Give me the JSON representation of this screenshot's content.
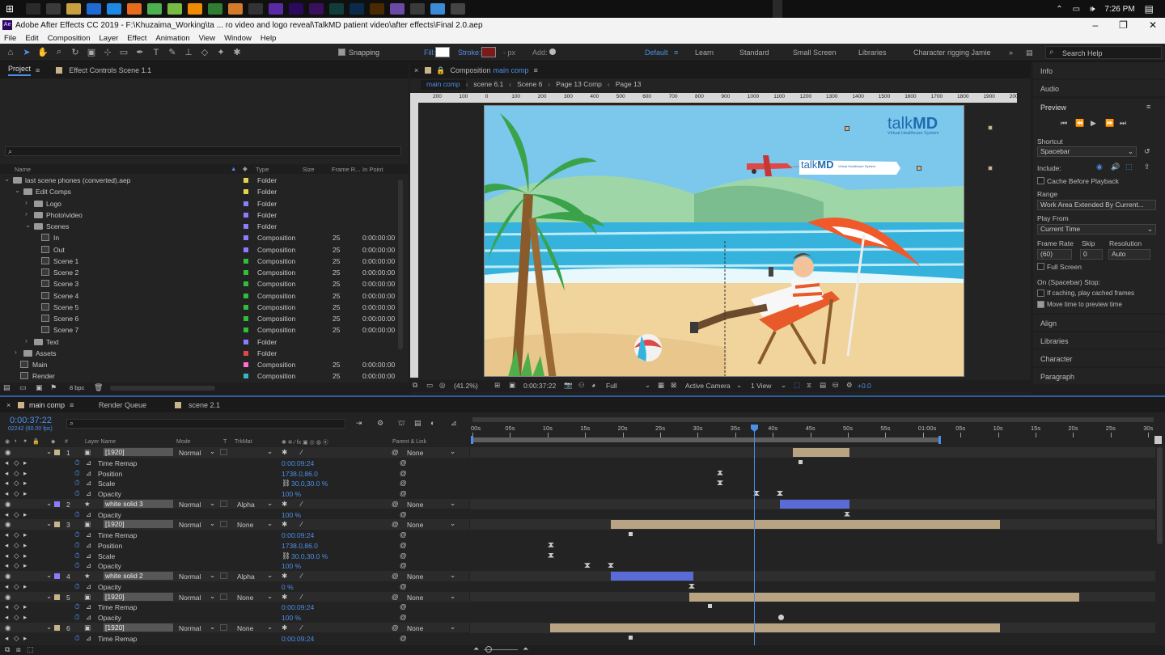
{
  "taskbar": {
    "time": "7:26 PM",
    "icons": [
      "windows-icon",
      "task-view-icon",
      "file-explorer-icon",
      "folder-icon",
      "outlook-icon",
      "skype-icon",
      "firefox-icon",
      "chrome-icon",
      "app-icon",
      "vlc-icon",
      "camtasia-icon",
      "blender-icon",
      "obs-icon",
      "character-animator-icon",
      "after-effects-icon",
      "premiere-icon",
      "audition-icon",
      "photoshop-icon",
      "illustrator-icon",
      "pen-icon",
      "drop-icon",
      "globe-icon",
      "photos-icon"
    ]
  },
  "window": {
    "title": "Adobe After Effects CC 2019 - F:\\Khuzaima_Working\\ta ... ro video and logo reveal\\TalkMD patient video\\after effects\\Final 2.0.aep",
    "app_badge": "Ae"
  },
  "menu": [
    "File",
    "Edit",
    "Composition",
    "Layer",
    "Effect",
    "Animation",
    "View",
    "Window",
    "Help"
  ],
  "toolbar": {
    "snapping": "Snapping",
    "fill": "Fill:",
    "stroke": "Stroke:",
    "px": "- px",
    "add": "Add:",
    "workspaces": [
      "Default",
      "Learn",
      "Standard",
      "Small Screen",
      "Libraries",
      "Character rigging Jamie"
    ],
    "search": "Search Help"
  },
  "project": {
    "tab": "Project",
    "effect_tab": "Effect Controls Scene 1.1",
    "columns": [
      "Name",
      "Type",
      "Size",
      "Frame R...",
      "In Point"
    ],
    "bpc": "8 bpc",
    "items": [
      {
        "indent": 0,
        "name": "last scene phones (converted).aep",
        "type": "Folder",
        "color": "#e7d34a",
        "kind": "folder",
        "arrow": "v"
      },
      {
        "indent": 1,
        "name": "Edit Comps",
        "type": "Folder",
        "color": "#e7d34a",
        "kind": "folder",
        "arrow": "v"
      },
      {
        "indent": 2,
        "name": "Logo",
        "type": "Folder",
        "color": "#8a7dff",
        "kind": "folder",
        "arrow": ">"
      },
      {
        "indent": 2,
        "name": "Photo\\video",
        "type": "Folder",
        "color": "#8a7dff",
        "kind": "folder",
        "arrow": ">"
      },
      {
        "indent": 2,
        "name": "Scenes",
        "type": "Folder",
        "color": "#8a7dff",
        "kind": "folder",
        "arrow": "v"
      },
      {
        "indent": 3,
        "name": "In",
        "type": "Composition",
        "color": "#8a7dff",
        "kind": "comp",
        "fr": "25",
        "inp": "0:00:00:00"
      },
      {
        "indent": 3,
        "name": "Out",
        "type": "Composition",
        "color": "#8a7dff",
        "kind": "comp",
        "fr": "25",
        "inp": "0:00:00:00"
      },
      {
        "indent": 3,
        "name": "Scene 1",
        "type": "Composition",
        "color": "#2fbf3a",
        "kind": "comp",
        "fr": "25",
        "inp": "0:00:00:00"
      },
      {
        "indent": 3,
        "name": "Scene 2",
        "type": "Composition",
        "color": "#2fbf3a",
        "kind": "comp",
        "fr": "25",
        "inp": "0:00:00:00"
      },
      {
        "indent": 3,
        "name": "Scene 3",
        "type": "Composition",
        "color": "#2fbf3a",
        "kind": "comp",
        "fr": "25",
        "inp": "0:00:00:00"
      },
      {
        "indent": 3,
        "name": "Scene 4",
        "type": "Composition",
        "color": "#2fbf3a",
        "kind": "comp",
        "fr": "25",
        "inp": "0:00:00:00"
      },
      {
        "indent": 3,
        "name": "Scene 5",
        "type": "Composition",
        "color": "#2fbf3a",
        "kind": "comp",
        "fr": "25",
        "inp": "0:00:00:00"
      },
      {
        "indent": 3,
        "name": "Scene 6",
        "type": "Composition",
        "color": "#2fbf3a",
        "kind": "comp",
        "fr": "25",
        "inp": "0:00:00:00"
      },
      {
        "indent": 3,
        "name": "Scene 7",
        "type": "Composition",
        "color": "#2fbf3a",
        "kind": "comp",
        "fr": "25",
        "inp": "0:00:00:00"
      },
      {
        "indent": 2,
        "name": "Text",
        "type": "Folder",
        "color": "#8a7dff",
        "kind": "folder",
        "arrow": ">"
      },
      {
        "indent": 1,
        "name": "Assets",
        "type": "Folder",
        "color": "#e04848",
        "kind": "folder",
        "arrow": ">"
      },
      {
        "indent": 1,
        "name": "Main",
        "type": "Composition",
        "color": "#ff6fd0",
        "kind": "comp",
        "fr": "25",
        "inp": "0:00:00:00"
      },
      {
        "indent": 1,
        "name": "Render",
        "type": "Composition",
        "color": "#3ab5c7",
        "kind": "comp",
        "fr": "25",
        "inp": "0:00:00:00"
      }
    ]
  },
  "composition": {
    "title": "Composition",
    "name": "main comp",
    "crumbs": [
      "main comp",
      "scene 6.1",
      "Scene 6",
      "Page 13 Comp",
      "Page 13"
    ],
    "ruler": [
      "200",
      "100",
      "0",
      "100",
      "200",
      "300",
      "400",
      "500",
      "600",
      "700",
      "800",
      "900",
      "1000",
      "1100",
      "1200",
      "1300",
      "1400",
      "1500",
      "1600",
      "1700",
      "1800",
      "1900",
      "2000"
    ],
    "zoom": "(41.2%)",
    "timecode": "0:00:37:22",
    "resolution": "Full",
    "camera": "Active Camera",
    "views": "1 View",
    "exposure": "+0.0",
    "logo_talk": "talk",
    "logo_md": "MD",
    "logo_tagline": "Virtual Healthcare System",
    "banner_tagline": "Virtual Healthcare System",
    "colors": {
      "sky": "#7cc8ec",
      "sea": "#35b3dd",
      "sand": "#f1d49c",
      "logo_blue": "#1f6bb0"
    }
  },
  "right": {
    "info": "Info",
    "audio": "Audio",
    "preview": "Preview",
    "shortcut_label": "Shortcut",
    "shortcut": "Spacebar",
    "include": "Include:",
    "cache": "Cache Before Playback",
    "range_label": "Range",
    "range": "Work Area Extended By Current...",
    "playfrom_label": "Play From",
    "playfrom": "Current Time",
    "fr_label": "Frame Rate",
    "skip_label": "Skip",
    "res_label": "Resolution",
    "fr": "(60)",
    "skip": "0",
    "res": "Auto",
    "fullscreen": "Full Screen",
    "stop": "On (Spacebar) Stop:",
    "ifcaching": "If caching, play cached frames",
    "movetime": "Move time to preview time",
    "align": "Align",
    "libraries": "Libraries",
    "character": "Character",
    "paragraph": "Paragraph"
  },
  "timeline": {
    "tabs": [
      "main comp",
      "Render Queue",
      "scene 2.1"
    ],
    "time": "0:00:37:22",
    "frames": "02242 (60.00 fps)",
    "cols": {
      "num": "#",
      "layer": "Layer Name",
      "mode": "Mode",
      "t": "T",
      "trkmat": "TrkMat",
      "parent": "Parent & Link"
    },
    "ruler": [
      "00s",
      "05s",
      "10s",
      "15s",
      "20s",
      "25s",
      "30s",
      "35s",
      "40s",
      "45s",
      "50s",
      "55s",
      "01:00s",
      "05s",
      "10s",
      "15s",
      "20s",
      "25s",
      "30s"
    ],
    "rows": [
      {
        "kind": "layer",
        "num": "1",
        "name": "[1920]",
        "color": "#c9b48a",
        "mode": "Normal",
        "trk": "",
        "parent": "None",
        "bar": [
          980,
          1050
        ],
        "bar_color": "#b8a382",
        "star": false
      },
      {
        "kind": "prop",
        "name": "Time Remap",
        "val": "0:00:09:24",
        "kf": [
          [
            990,
            "d"
          ]
        ]
      },
      {
        "kind": "prop",
        "name": "Position",
        "val": "1738.0,86.0",
        "kf": [
          [
            890,
            "h"
          ]
        ]
      },
      {
        "kind": "prop",
        "name": "Scale",
        "val": "30.0,30.0 %",
        "link": true,
        "kf": [
          [
            890,
            "h"
          ]
        ]
      },
      {
        "kind": "prop",
        "name": "Opacity",
        "val": "100 %",
        "kf": [
          [
            935,
            "h"
          ],
          [
            964,
            "h"
          ]
        ]
      },
      {
        "kind": "layer",
        "num": "2",
        "name": "white solid 3",
        "color": "#8a7dff",
        "mode": "Normal",
        "trk": "Alpha",
        "parent": "None",
        "bar": [
          964,
          1050
        ],
        "bar_color": "#5a6ad6",
        "star": true
      },
      {
        "kind": "prop",
        "name": "Opacity",
        "val": "100 %",
        "kf": [
          [
            1047,
            "h"
          ]
        ]
      },
      {
        "kind": "layer",
        "num": "3",
        "name": "[1920]",
        "color": "#c9b48a",
        "mode": "Normal",
        "trk": "None",
        "parent": "None",
        "bar": [
          755,
          1236
        ],
        "bar_color": "#b8a382",
        "star": false
      },
      {
        "kind": "prop",
        "name": "Time Remap",
        "val": "0:00:09:24",
        "kf": [
          [
            780,
            "d"
          ]
        ]
      },
      {
        "kind": "prop",
        "name": "Position",
        "val": "1738.0,86.0",
        "kf": [
          [
            681,
            "h"
          ]
        ]
      },
      {
        "kind": "prop",
        "name": "Scale",
        "val": "30.0,30.0 %",
        "link": true,
        "kf": [
          [
            681,
            "h"
          ]
        ]
      },
      {
        "kind": "prop",
        "name": "Opacity",
        "val": "100 %",
        "kf": [
          [
            726,
            "h"
          ],
          [
            755,
            "h"
          ]
        ]
      },
      {
        "kind": "layer",
        "num": "4",
        "name": "white solid 2",
        "color": "#8a7dff",
        "mode": "Normal",
        "trk": "Alpha",
        "parent": "None",
        "bar": [
          755,
          857
        ],
        "bar_color": "#5a6ad6",
        "star": true
      },
      {
        "kind": "prop",
        "name": "Opacity",
        "val": "0 %",
        "kf": [
          [
            855,
            "h"
          ]
        ]
      },
      {
        "kind": "layer",
        "num": "5",
        "name": "[1920]",
        "color": "#c9b48a",
        "mode": "Normal",
        "trk": "None",
        "parent": "None",
        "bar": [
          852,
          1334
        ],
        "bar_color": "#b8a382",
        "star": false
      },
      {
        "kind": "prop",
        "name": "Time Remap",
        "val": "0:00:09:24",
        "kf": [
          [
            878,
            "d"
          ]
        ]
      },
      {
        "kind": "prop",
        "name": "Opacity",
        "val": "100 %",
        "kf": [
          [
            965,
            "o"
          ]
        ]
      },
      {
        "kind": "layer",
        "num": "6",
        "name": "[1920]",
        "color": "#c9b48a",
        "mode": "Normal",
        "trk": "None",
        "parent": "None",
        "bar": [
          680,
          1236
        ],
        "bar_color": "#b8a382",
        "star": false
      },
      {
        "kind": "prop",
        "name": "Time Remap",
        "val": "0:00:09:24",
        "kf": [
          [
            780,
            "d"
          ]
        ]
      }
    ]
  }
}
